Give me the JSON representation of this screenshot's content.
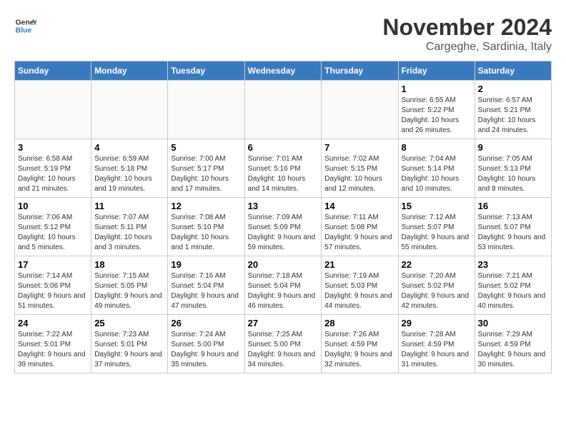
{
  "header": {
    "logo_line1": "General",
    "logo_line2": "Blue",
    "month_year": "November 2024",
    "location": "Cargeghe, Sardinia, Italy"
  },
  "weekdays": [
    "Sunday",
    "Monday",
    "Tuesday",
    "Wednesday",
    "Thursday",
    "Friday",
    "Saturday"
  ],
  "weeks": [
    [
      {
        "day": "",
        "info": ""
      },
      {
        "day": "",
        "info": ""
      },
      {
        "day": "",
        "info": ""
      },
      {
        "day": "",
        "info": ""
      },
      {
        "day": "",
        "info": ""
      },
      {
        "day": "1",
        "info": "Sunrise: 6:55 AM\nSunset: 5:22 PM\nDaylight: 10 hours and 26 minutes."
      },
      {
        "day": "2",
        "info": "Sunrise: 6:57 AM\nSunset: 5:21 PM\nDaylight: 10 hours and 24 minutes."
      }
    ],
    [
      {
        "day": "3",
        "info": "Sunrise: 6:58 AM\nSunset: 5:19 PM\nDaylight: 10 hours and 21 minutes."
      },
      {
        "day": "4",
        "info": "Sunrise: 6:59 AM\nSunset: 5:18 PM\nDaylight: 10 hours and 19 minutes."
      },
      {
        "day": "5",
        "info": "Sunrise: 7:00 AM\nSunset: 5:17 PM\nDaylight: 10 hours and 17 minutes."
      },
      {
        "day": "6",
        "info": "Sunrise: 7:01 AM\nSunset: 5:16 PM\nDaylight: 10 hours and 14 minutes."
      },
      {
        "day": "7",
        "info": "Sunrise: 7:02 AM\nSunset: 5:15 PM\nDaylight: 10 hours and 12 minutes."
      },
      {
        "day": "8",
        "info": "Sunrise: 7:04 AM\nSunset: 5:14 PM\nDaylight: 10 hours and 10 minutes."
      },
      {
        "day": "9",
        "info": "Sunrise: 7:05 AM\nSunset: 5:13 PM\nDaylight: 10 hours and 8 minutes."
      }
    ],
    [
      {
        "day": "10",
        "info": "Sunrise: 7:06 AM\nSunset: 5:12 PM\nDaylight: 10 hours and 5 minutes."
      },
      {
        "day": "11",
        "info": "Sunrise: 7:07 AM\nSunset: 5:11 PM\nDaylight: 10 hours and 3 minutes."
      },
      {
        "day": "12",
        "info": "Sunrise: 7:08 AM\nSunset: 5:10 PM\nDaylight: 10 hours and 1 minute."
      },
      {
        "day": "13",
        "info": "Sunrise: 7:09 AM\nSunset: 5:09 PM\nDaylight: 9 hours and 59 minutes."
      },
      {
        "day": "14",
        "info": "Sunrise: 7:11 AM\nSunset: 5:08 PM\nDaylight: 9 hours and 57 minutes."
      },
      {
        "day": "15",
        "info": "Sunrise: 7:12 AM\nSunset: 5:07 PM\nDaylight: 9 hours and 55 minutes."
      },
      {
        "day": "16",
        "info": "Sunrise: 7:13 AM\nSunset: 5:07 PM\nDaylight: 9 hours and 53 minutes."
      }
    ],
    [
      {
        "day": "17",
        "info": "Sunrise: 7:14 AM\nSunset: 5:06 PM\nDaylight: 9 hours and 51 minutes."
      },
      {
        "day": "18",
        "info": "Sunrise: 7:15 AM\nSunset: 5:05 PM\nDaylight: 9 hours and 49 minutes."
      },
      {
        "day": "19",
        "info": "Sunrise: 7:16 AM\nSunset: 5:04 PM\nDaylight: 9 hours and 47 minutes."
      },
      {
        "day": "20",
        "info": "Sunrise: 7:18 AM\nSunset: 5:04 PM\nDaylight: 9 hours and 46 minutes."
      },
      {
        "day": "21",
        "info": "Sunrise: 7:19 AM\nSunset: 5:03 PM\nDaylight: 9 hours and 44 minutes."
      },
      {
        "day": "22",
        "info": "Sunrise: 7:20 AM\nSunset: 5:02 PM\nDaylight: 9 hours and 42 minutes."
      },
      {
        "day": "23",
        "info": "Sunrise: 7:21 AM\nSunset: 5:02 PM\nDaylight: 9 hours and 40 minutes."
      }
    ],
    [
      {
        "day": "24",
        "info": "Sunrise: 7:22 AM\nSunset: 5:01 PM\nDaylight: 9 hours and 39 minutes."
      },
      {
        "day": "25",
        "info": "Sunrise: 7:23 AM\nSunset: 5:01 PM\nDaylight: 9 hours and 37 minutes."
      },
      {
        "day": "26",
        "info": "Sunrise: 7:24 AM\nSunset: 5:00 PM\nDaylight: 9 hours and 35 minutes."
      },
      {
        "day": "27",
        "info": "Sunrise: 7:25 AM\nSunset: 5:00 PM\nDaylight: 9 hours and 34 minutes."
      },
      {
        "day": "28",
        "info": "Sunrise: 7:26 AM\nSunset: 4:59 PM\nDaylight: 9 hours and 32 minutes."
      },
      {
        "day": "29",
        "info": "Sunrise: 7:28 AM\nSunset: 4:59 PM\nDaylight: 9 hours and 31 minutes."
      },
      {
        "day": "30",
        "info": "Sunrise: 7:29 AM\nSunset: 4:59 PM\nDaylight: 9 hours and 30 minutes."
      }
    ]
  ]
}
